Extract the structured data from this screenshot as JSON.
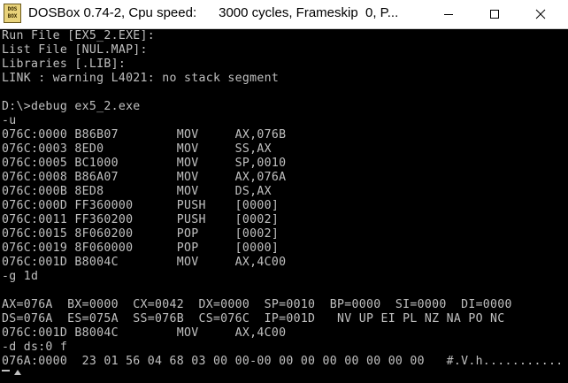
{
  "window": {
    "title": "DOSBox 0.74-2, Cpu speed:      3000 cycles, Frameskip  0, P...",
    "icon_label_top": "DOS",
    "icon_label_bottom": "BOX"
  },
  "icons": {
    "app": "dosbox-icon",
    "minimize": "minimize-icon",
    "maximize": "maximize-icon",
    "close": "close-icon"
  },
  "terminal": {
    "lines": [
      "Run File [EX5_2.EXE]:",
      "List File [NUL.MAP]:",
      "Libraries [.LIB]:",
      "LINK : warning L4021: no stack segment",
      "",
      "D:\\>debug ex5_2.exe",
      "-u",
      "076C:0000 B86B07        MOV     AX,076B",
      "076C:0003 8ED0          MOV     SS,AX",
      "076C:0005 BC1000        MOV     SP,0010",
      "076C:0008 B86A07        MOV     AX,076A",
      "076C:000B 8ED8          MOV     DS,AX",
      "076C:000D FF360000      PUSH    [0000]",
      "076C:0011 FF360200      PUSH    [0002]",
      "076C:0015 8F060200      POP     [0002]",
      "076C:0019 8F060000      POP     [0000]",
      "076C:001D B8004C        MOV     AX,4C00",
      "-g 1d",
      "",
      "AX=076A  BX=0000  CX=0042  DX=0000  SP=0010  BP=0000  SI=0000  DI=0000",
      "DS=076A  ES=075A  SS=076B  CS=076C  IP=001D   NV UP EI PL NZ NA PO NC",
      "076C:001D B8004C        MOV     AX,4C00",
      "-d ds:0 f",
      "076A:0000  23 01 56 04 68 03 00 00-00 00 00 00 00 00 00 00   #.V.h..........."
    ]
  }
}
